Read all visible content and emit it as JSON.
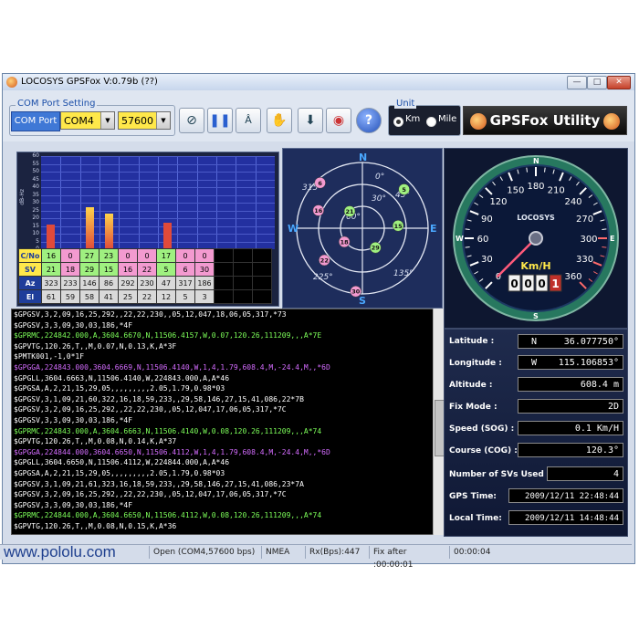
{
  "window": {
    "title": "LOCOSYS GPSFox V:0.79b (??)",
    "min_glyph": "—",
    "max_glyph": "□",
    "close_glyph": "✕"
  },
  "com": {
    "group_title": "COM Port Setting",
    "label": "COM Port",
    "port": "COM4",
    "baud": "57600"
  },
  "toolbar_icons": [
    "satellite-icon",
    "pause-icon",
    "font-icon",
    "hand-icon",
    "save-icon",
    "record-icon",
    "help-icon"
  ],
  "unit": {
    "group_title": "Unit",
    "km_label": "Km",
    "mile_label": "Mile",
    "selected": "Km"
  },
  "brand": {
    "text": "GPSFox Utility"
  },
  "snr_chart": {
    "ylabel": "dB-Hz",
    "yticks": [
      "0",
      "5",
      "10",
      "15",
      "20",
      "25",
      "30",
      "35",
      "40",
      "45",
      "50",
      "55",
      "60"
    ],
    "ymax": 60,
    "slot_count": 12,
    "bar_color": "#e04a3a"
  },
  "sat_table": {
    "row_labels": [
      "C/No",
      "SV",
      "Az",
      "El"
    ],
    "cno": [
      "16",
      "0",
      "27",
      "23",
      "0",
      "0",
      "17",
      "0",
      "0"
    ],
    "sv": [
      "21",
      "18",
      "29",
      "15",
      "16",
      "22",
      "5",
      "6",
      "30"
    ],
    "az": [
      "323",
      "233",
      "146",
      "86",
      "292",
      "230",
      "47",
      "317",
      "186"
    ],
    "el": [
      "61",
      "59",
      "58",
      "41",
      "25",
      "22",
      "12",
      "5",
      "3"
    ],
    "cno_colors": [
      "#9ff080",
      "#f39ad0",
      "#9ff080",
      "#9ff080",
      "#f39ad0",
      "#f39ad0",
      "#9ff080",
      "#f39ad0",
      "#f39ad0"
    ],
    "sv_colors": [
      "#9ff080",
      "#f39ad0",
      "#9ff080",
      "#9ff080",
      "#f39ad0",
      "#f39ad0",
      "#9ff080",
      "#f39ad0",
      "#f39ad0"
    ]
  },
  "skyview": {
    "compass": {
      "N": "N",
      "S": "S",
      "E": "E",
      "W": "W"
    },
    "angle_labels": [
      "0°",
      "30°",
      "60°",
      "45°",
      "135°",
      "225°",
      "315°"
    ],
    "satellites": [
      {
        "id": "21",
        "az": 323,
        "el": 61,
        "used": true
      },
      {
        "id": "18",
        "az": 233,
        "el": 59,
        "used": false
      },
      {
        "id": "29",
        "az": 146,
        "el": 58,
        "used": true
      },
      {
        "id": "15",
        "az": 86,
        "el": 41,
        "used": true
      },
      {
        "id": "16",
        "az": 292,
        "el": 25,
        "used": false
      },
      {
        "id": "22",
        "az": 230,
        "el": 22,
        "used": false
      },
      {
        "id": "5",
        "az": 47,
        "el": 12,
        "used": true
      },
      {
        "id": "6",
        "az": 317,
        "el": 5,
        "used": false
      },
      {
        "id": "30",
        "az": 186,
        "el": 3,
        "used": false
      }
    ]
  },
  "speedometer": {
    "brand": "LOCOSYS",
    "unit": "Km/H",
    "scale": [
      "0",
      "30",
      "60",
      "90",
      "120",
      "150",
      "180",
      "210",
      "240",
      "270",
      "300",
      "330",
      "360"
    ],
    "value": 0.1,
    "odometer": [
      "0",
      "0",
      "0",
      "1"
    ],
    "compass": {
      "N": "N",
      "E": "E",
      "S": "S",
      "W": "W"
    }
  },
  "nmea_lines": [
    {
      "text": "$GPGSV,3,2,09,16,25,292,,22,22,230,,05,12,047,18,06,05,317,*73",
      "color": "#ffffff"
    },
    {
      "text": "$GPGSV,3,3,09,30,03,186,*4F",
      "color": "#ffffff"
    },
    {
      "text": "$GPRMC,224842.000,A,3604.6670,N,11506.4157,W,0.07,120.26,111209,,,A*7E",
      "color": "#7dff5a"
    },
    {
      "text": "$GPVTG,120.26,T,,M,0.07,N,0.13,K,A*3F",
      "color": "#ffffff"
    },
    {
      "text": "$PMTK001,-1,0*1F",
      "color": "#ffffff"
    },
    {
      "text": "$GPGGA,224843.000,3604.6669,N,11506.4140,W,1,4,1.79,608.4,M,-24.4,M,,*6D",
      "color": "#d46cff"
    },
    {
      "text": "$GPGLL,3604.6663,N,11506.4140,W,224843.000,A,A*46",
      "color": "#ffffff"
    },
    {
      "text": "$GPGSA,A,2,21,15,29,05,,,,,,,,,2.05,1.79,0.98*03",
      "color": "#ffffff"
    },
    {
      "text": "$GPGSV,3,1,09,21,60,322,16,18,59,233,,29,58,146,27,15,41,086,22*7B",
      "color": "#ffffff"
    },
    {
      "text": "$GPGSV,3,2,09,16,25,292,,22,22,230,,05,12,047,17,06,05,317,*7C",
      "color": "#ffffff"
    },
    {
      "text": "$GPGSV,3,3,09,30,03,186,*4F",
      "color": "#ffffff"
    },
    {
      "text": "$GPRMC,224843.000,A,3604.6663,N,11506.4140,W,0.08,120.26,111209,,,A*74",
      "color": "#7dff5a"
    },
    {
      "text": "$GPVTG,120.26,T,,M,0.08,N,0.14,K,A*37",
      "color": "#ffffff"
    },
    {
      "text": "$GPGGA,224844.000,3604.6650,N,11506.4112,W,1,4,1.79,608.4,M,-24.4,M,,*6D",
      "color": "#d46cff"
    },
    {
      "text": "$GPGLL,3604.6650,N,11506.4112,W,224844.000,A,A*46",
      "color": "#ffffff"
    },
    {
      "text": "$GPGSA,A,2,21,15,29,05,,,,,,,,,2.05,1.79,0.98*03",
      "color": "#ffffff"
    },
    {
      "text": "$GPGSV,3,1,09,21,61,323,16,18,59,233,,29,58,146,27,15,41,086,23*7A",
      "color": "#ffffff"
    },
    {
      "text": "$GPGSV,3,2,09,16,25,292,,22,22,230,,05,12,047,17,06,05,317,*7C",
      "color": "#ffffff"
    },
    {
      "text": "$GPGSV,3,3,09,30,03,186,*4F",
      "color": "#ffffff"
    },
    {
      "text": "$GPRMC,224844.000,A,3604.6650,N,11506.4112,W,0.08,120.26,111209,,,A*74",
      "color": "#7dff5a"
    },
    {
      "text": "$GPVTG,120.26,T,,M,0.08,N,0.15,K,A*36",
      "color": "#ffffff"
    }
  ],
  "info": {
    "latitude_label": "Latitude :",
    "latitude_hemi": "N",
    "latitude": "36.077750°",
    "longitude_label": "Longitude :",
    "longitude_hemi": "W",
    "longitude": "115.106853°",
    "altitude_label": "Altitude :",
    "altitude": "608.4 m",
    "fixmode_label": "Fix Mode :",
    "fixmode": "2D",
    "speed_label": "Speed (SOG) :",
    "speed": "0.1 Km/H",
    "course_label": "Course (COG) :",
    "course": "120.3°",
    "svs_label": "Number of SVs Used :",
    "svs": "4",
    "gpstime_label": "GPS   Time:",
    "gpstime": "2009/12/11 22:48:44",
    "localtime_label": "Local Time:",
    "localtime": "2009/12/11 14:48:44"
  },
  "status": {
    "port": "Open (COM4,57600 bps)",
    "protocol": "NMEA",
    "rx": "Rx(Bps):447",
    "fix_after": "Fix after :00:00:01",
    "elapsed": "00:00:04"
  },
  "watermark": "www.pololu.com",
  "colors": {
    "used_sat": "#9ff080",
    "unused_sat": "#f39ad0",
    "accent": "#1c4fa8"
  }
}
